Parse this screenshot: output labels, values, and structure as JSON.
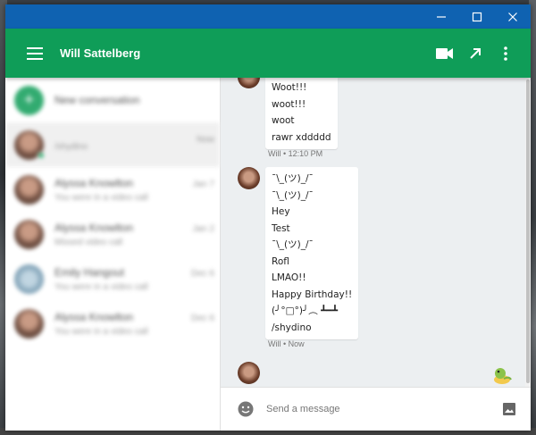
{
  "window": {
    "controls": [
      "minimize-icon",
      "maximize-icon",
      "close-icon"
    ]
  },
  "appbar": {
    "title": "Will Sattelberg",
    "actions": [
      "video-call-icon",
      "open-external-icon",
      "more-vert-icon"
    ],
    "color": "#0f9d58"
  },
  "sidebar": {
    "new_conversation": "New conversation",
    "conversations": [
      {
        "name": "",
        "snippet": "/shydino",
        "time": "Now",
        "selected": true
      },
      {
        "name": "Alyssa Knowlton",
        "snippet": "You were in a video call",
        "time": "Jan 7"
      },
      {
        "name": "Alyssa Knowlton",
        "snippet": "Missed video call",
        "time": "Jan 2"
      },
      {
        "name": "Emily Hangout",
        "snippet": "You were in a video call",
        "time": "Dec 6"
      },
      {
        "name": "Alyssa Knowlton",
        "snippet": "You were in a video call",
        "time": "Dec 6"
      }
    ]
  },
  "chat": {
    "group1": {
      "lines": [
        "Woot!!!",
        "woot!!!",
        "woot",
        "rawr xddddd"
      ],
      "meta": "Will • 12:10 PM"
    },
    "group2": {
      "lines": [
        "¯\\_(ツ)_/¯",
        "¯\\_(ツ)_/¯",
        "Hey",
        "Test",
        "¯\\_(ツ)_/¯",
        "Rofl",
        "LMAO!!",
        "Happy Birthday!!",
        "(╯°□°)╯︵ ┻━┻",
        "/shydino"
      ],
      "meta": "Will • Now"
    }
  },
  "composer": {
    "placeholder": "Send a message"
  }
}
